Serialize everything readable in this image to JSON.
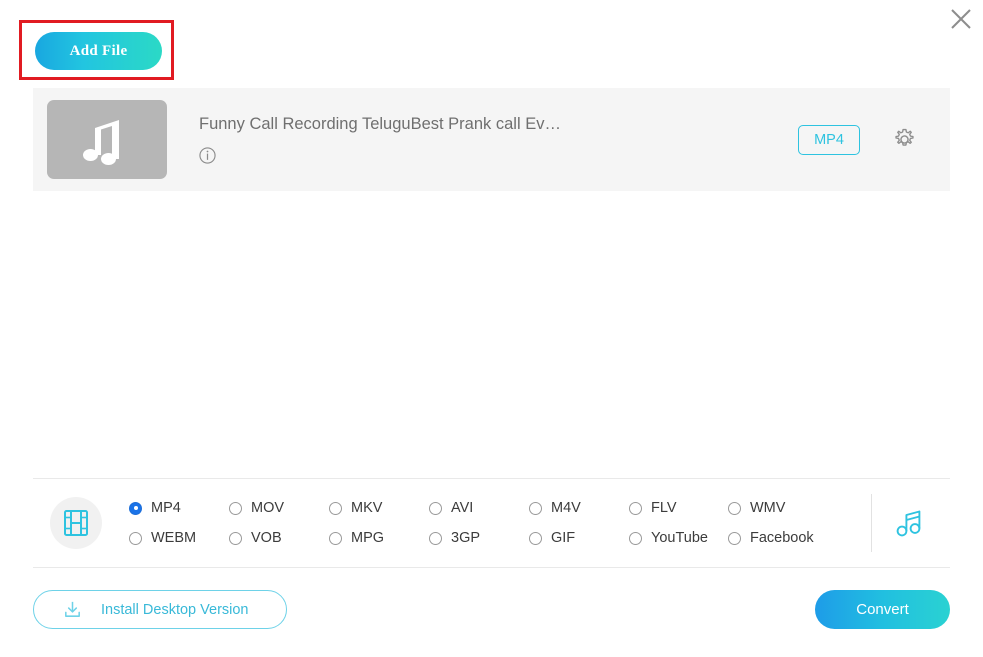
{
  "window": {
    "close_label": "close-icon"
  },
  "toolbar": {
    "add_file_label": "Add File"
  },
  "file_list": {
    "items": [
      {
        "title": "Funny Call Recording TeluguBest Prank call Ev…",
        "thumbnail_icon": "music-note-icon",
        "info_icon": "info-icon",
        "format_badge": "MP4",
        "settings_icon": "gear-icon"
      }
    ]
  },
  "format_bar": {
    "video_icon": "film-strip-icon",
    "audio_icon": "music-note-icon",
    "selected": "MP4",
    "options": [
      "MP4",
      "MOV",
      "MKV",
      "AVI",
      "M4V",
      "FLV",
      "WMV",
      "WEBM",
      "VOB",
      "MPG",
      "3GP",
      "GIF",
      "YouTube",
      "Facebook"
    ]
  },
  "footer": {
    "install_label": "Install Desktop Version",
    "install_icon": "download-icon",
    "convert_label": "Convert"
  },
  "colors": {
    "accent_cyan": "#2ec3e0",
    "accent_blue": "#1a73e8",
    "annotation_red": "#e11b22",
    "row_background": "#f5f5f5",
    "thumbnail_gray": "#b6b6b6"
  }
}
